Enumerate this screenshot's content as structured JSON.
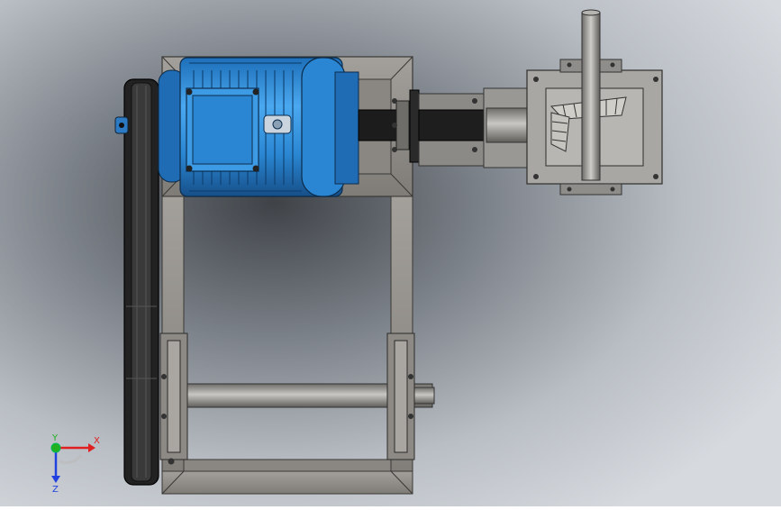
{
  "viewport": {
    "background_colors": [
      "#5e656c",
      "#aeb3b9",
      "#d3d7dc"
    ]
  },
  "triad": {
    "x_label": "X",
    "y_label": "Y",
    "z_label": "Z",
    "x_color": "#e02020",
    "y_color": "#20b020",
    "z_color": "#2040e0"
  },
  "colors": {
    "frame": "#8f8b86",
    "motor": "#2f8fd8",
    "belt": "#1a1a1a",
    "shaft": "#9a9894",
    "gearbox": "#a8a6a2"
  }
}
